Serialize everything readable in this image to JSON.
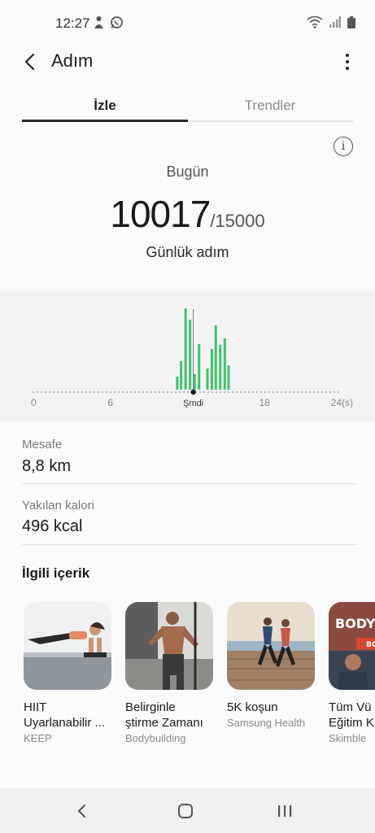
{
  "status_bar": {
    "time": "12:27"
  },
  "header": {
    "title": "Adım",
    "back_icon": "chevron-left-icon",
    "more_icon": "more-vertical-icon"
  },
  "tabs": [
    {
      "label": "İzle",
      "active": true
    },
    {
      "label": "Trendler",
      "active": false
    }
  ],
  "summary": {
    "info_icon": "i",
    "period": "Bugün",
    "steps": "10017",
    "goal": "/15000",
    "label": "Günlük adım"
  },
  "chart_data": {
    "type": "bar",
    "x_ticks": [
      "0",
      "6",
      "Şmdi",
      "18",
      "24(s)"
    ],
    "values": [
      0,
      0,
      0,
      0,
      0,
      0,
      0,
      0,
      0,
      0,
      0,
      0,
      0,
      0,
      0,
      0,
      0,
      0,
      0,
      0,
      0,
      0,
      0,
      0,
      0,
      0,
      0,
      0,
      0,
      0,
      0,
      0,
      0,
      0,
      0,
      0,
      0,
      0,
      0,
      0,
      0,
      0,
      0,
      0,
      0,
      0,
      0,
      0,
      0,
      0,
      0,
      0,
      0,
      0,
      0,
      0,
      0,
      0,
      0,
      0,
      0,
      0,
      0,
      0,
      0,
      0,
      0,
      0,
      0,
      0,
      0,
      0,
      0,
      0,
      0,
      0,
      0,
      0,
      0,
      0,
      0,
      0,
      0,
      0,
      0,
      0,
      0,
      0,
      0,
      0,
      0,
      0,
      0,
      0,
      0,
      0,
      0,
      0,
      0,
      0,
      0,
      0,
      0,
      0,
      0,
      0,
      0,
      0,
      0,
      0,
      0,
      0,
      0,
      0,
      0,
      0,
      0,
      0,
      0,
      0,
      0,
      0,
      0,
      0,
      0,
      0,
      0,
      0,
      0,
      0,
      0,
      0,
      0,
      0,
      0,
      0,
      0,
      0,
      0,
      0,
      0,
      0,
      0,
      0,
      0,
      0,
      0,
      0,
      0,
      0,
      0,
      0,
      0,
      0,
      0,
      0,
      0,
      0,
      0,
      0,
      0,
      0,
      0,
      0,
      0,
      0,
      0,
      0,
      0,
      0,
      0,
      0,
      0,
      0,
      0,
      0,
      0,
      0,
      0,
      0,
      0,
      0,
      0,
      0,
      0,
      0,
      0,
      0,
      0,
      0,
      0,
      0,
      0,
      0,
      0,
      0,
      0,
      0,
      0,
      0,
      0,
      0,
      0,
      0,
      0,
      0,
      0,
      0,
      0,
      0,
      0,
      0,
      0,
      0,
      0,
      0,
      0,
      0,
      0,
      0,
      0,
      0,
      0,
      0,
      0,
      0,
      0,
      0,
      0,
      0,
      0,
      0,
      0,
      0,
      0,
      0,
      0,
      0,
      0,
      0,
      0,
      0,
      0,
      0,
      0,
      0,
      0,
      0,
      0,
      0,
      0,
      0,
      0,
      0,
      0,
      0,
      0,
      0,
      0,
      0,
      0,
      0,
      0,
      0,
      0,
      0,
      0,
      0,
      0,
      0,
      0,
      0,
      0,
      0,
      0,
      0,
      0,
      0,
      0,
      0,
      0,
      0,
      0,
      0,
      0,
      0,
      0,
      0,
      0,
      0,
      0,
      0,
      0,
      0
    ],
    "bars": [
      {
        "hour": 11.2,
        "value": 0.16
      },
      {
        "hour": 11.5,
        "value": 0.35
      },
      {
        "hour": 11.85,
        "value": 1.0
      },
      {
        "hour": 12.2,
        "value": 0.86
      },
      {
        "hour": 12.55,
        "value": 0.19
      },
      {
        "hour": 12.9,
        "value": 0.56
      },
      {
        "hour": 13.55,
        "value": 0.26
      },
      {
        "hour": 13.9,
        "value": 0.5
      },
      {
        "hour": 14.2,
        "value": 0.79
      },
      {
        "hour": 14.55,
        "value": 0.55
      },
      {
        "hour": 14.9,
        "value": 0.63
      },
      {
        "hour": 15.2,
        "value": 0.3
      }
    ],
    "now_hour": 12.45,
    "xlim": [
      0,
      24
    ],
    "bar_color": "#3ec46d"
  },
  "stats": {
    "distance_label": "Mesafe",
    "distance_value": "8,8 km",
    "calories_label": "Yakılan kalori",
    "calories_value": "496 kcal"
  },
  "related": {
    "title": "İlgili içerik",
    "cards": [
      {
        "title": "HIIT Uyarlanabilir ...",
        "source": "KEEP",
        "image": "plank-workout"
      },
      {
        "title": "Belirginle ştirme Zamanı",
        "source": "Bodybuilding",
        "image": "cable-workout"
      },
      {
        "title": "5K koşun",
        "source": "Samsung Health",
        "image": "runners"
      },
      {
        "title": "Tüm Vü Eğitim K",
        "source": "Skimble",
        "image": "body-boot",
        "badge": "BODY",
        "badge2": "BOOT"
      }
    ]
  },
  "nav": {
    "back": "back-icon",
    "home": "home-icon",
    "recents": "recents-icon"
  }
}
